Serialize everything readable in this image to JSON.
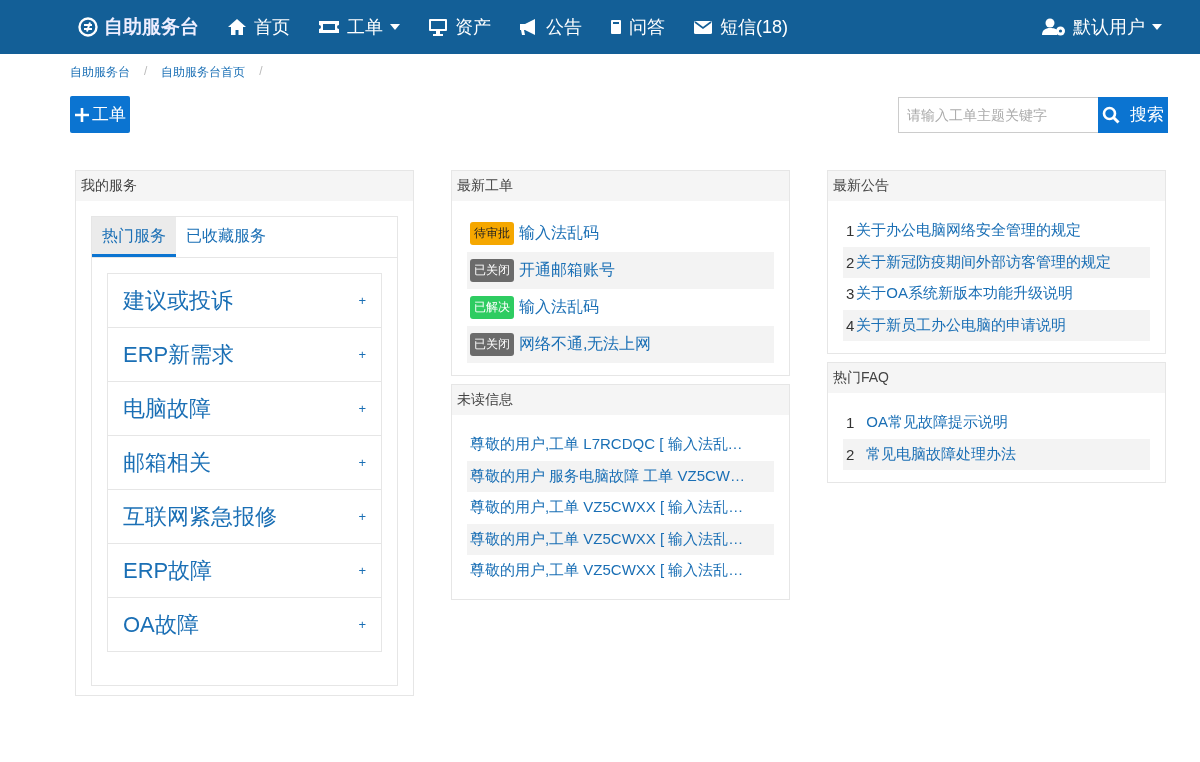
{
  "navbar": {
    "brand": "自助服务台",
    "items": [
      {
        "label": "首页",
        "kind": "home",
        "dropdown": false
      },
      {
        "label": "工单",
        "kind": "ticket",
        "dropdown": true
      },
      {
        "label": "资产",
        "kind": "monitor",
        "dropdown": false
      },
      {
        "label": "公告",
        "kind": "bullhorn",
        "dropdown": false
      },
      {
        "label": "问答",
        "kind": "book",
        "dropdown": false
      },
      {
        "label": "短信(18)",
        "kind": "envelope",
        "dropdown": false
      }
    ],
    "user": {
      "label": "默认用户",
      "dropdown": true
    }
  },
  "breadcrumb": [
    {
      "label": "自助服务台",
      "separator": "/"
    },
    {
      "label": "自助服务台首页",
      "separator": "/"
    }
  ],
  "new_ticket_button": "工单",
  "search": {
    "placeholder": "请输入工单主题关键字",
    "button": "搜索"
  },
  "my_services": {
    "title": "我的服务",
    "tabs": [
      {
        "label": "热门服务",
        "selected": true
      },
      {
        "label": "已收藏服务",
        "selected": false
      }
    ],
    "items": [
      {
        "label": "建议或投诉",
        "action": "+"
      },
      {
        "label": "ERP新需求",
        "action": "+"
      },
      {
        "label": "电脑故障",
        "action": "+"
      },
      {
        "label": "邮箱相关",
        "action": "+"
      },
      {
        "label": "互联网紧急报修",
        "action": "+"
      },
      {
        "label": "ERP故障",
        "action": "+"
      },
      {
        "label": "OA故障",
        "action": "+"
      }
    ]
  },
  "latest_tickets": {
    "title": "最新工单",
    "items": [
      {
        "status": "待审批",
        "color": "#f5a700",
        "title": "输入法乱码"
      },
      {
        "status": "已关闭",
        "color": "#6b6b6b",
        "title": "开通邮箱账号"
      },
      {
        "status": "已解决",
        "color": "#2ecc61",
        "title": "输入法乱码"
      },
      {
        "status": "已关闭",
        "color": "#6b6b6b",
        "title": "网络不通,无法上网"
      }
    ]
  },
  "unread_messages": {
    "title": "未读信息",
    "items": [
      "尊敬的用户,工单 L7RCDQC [ 输入法乱…",
      "尊敬的用户 服务电脑故障 工单 VZ5CW…",
      "尊敬的用户,工单 VZ5CWXX [ 输入法乱…",
      "尊敬的用户,工单 VZ5CWXX [ 输入法乱…",
      "尊敬的用户,工单 VZ5CWXX [ 输入法乱…"
    ]
  },
  "latest_notices": {
    "title": "最新公告",
    "items": [
      {
        "number": "1",
        "title": "关于办公电脑网络安全管理的规定"
      },
      {
        "number": "2",
        "title": "关于新冠防疫期间外部访客管理的规定"
      },
      {
        "number": "3",
        "title": "关于OA系统新版本功能升级说明"
      },
      {
        "number": "4",
        "title": "关于新员工办公电脑的申请说明"
      }
    ]
  },
  "hot_faq": {
    "title": "热门FAQ",
    "items": [
      {
        "number": "1",
        "title": "OA常见故障提示说明"
      },
      {
        "number": "2",
        "title": "常见电脑故障处理办法"
      }
    ]
  }
}
